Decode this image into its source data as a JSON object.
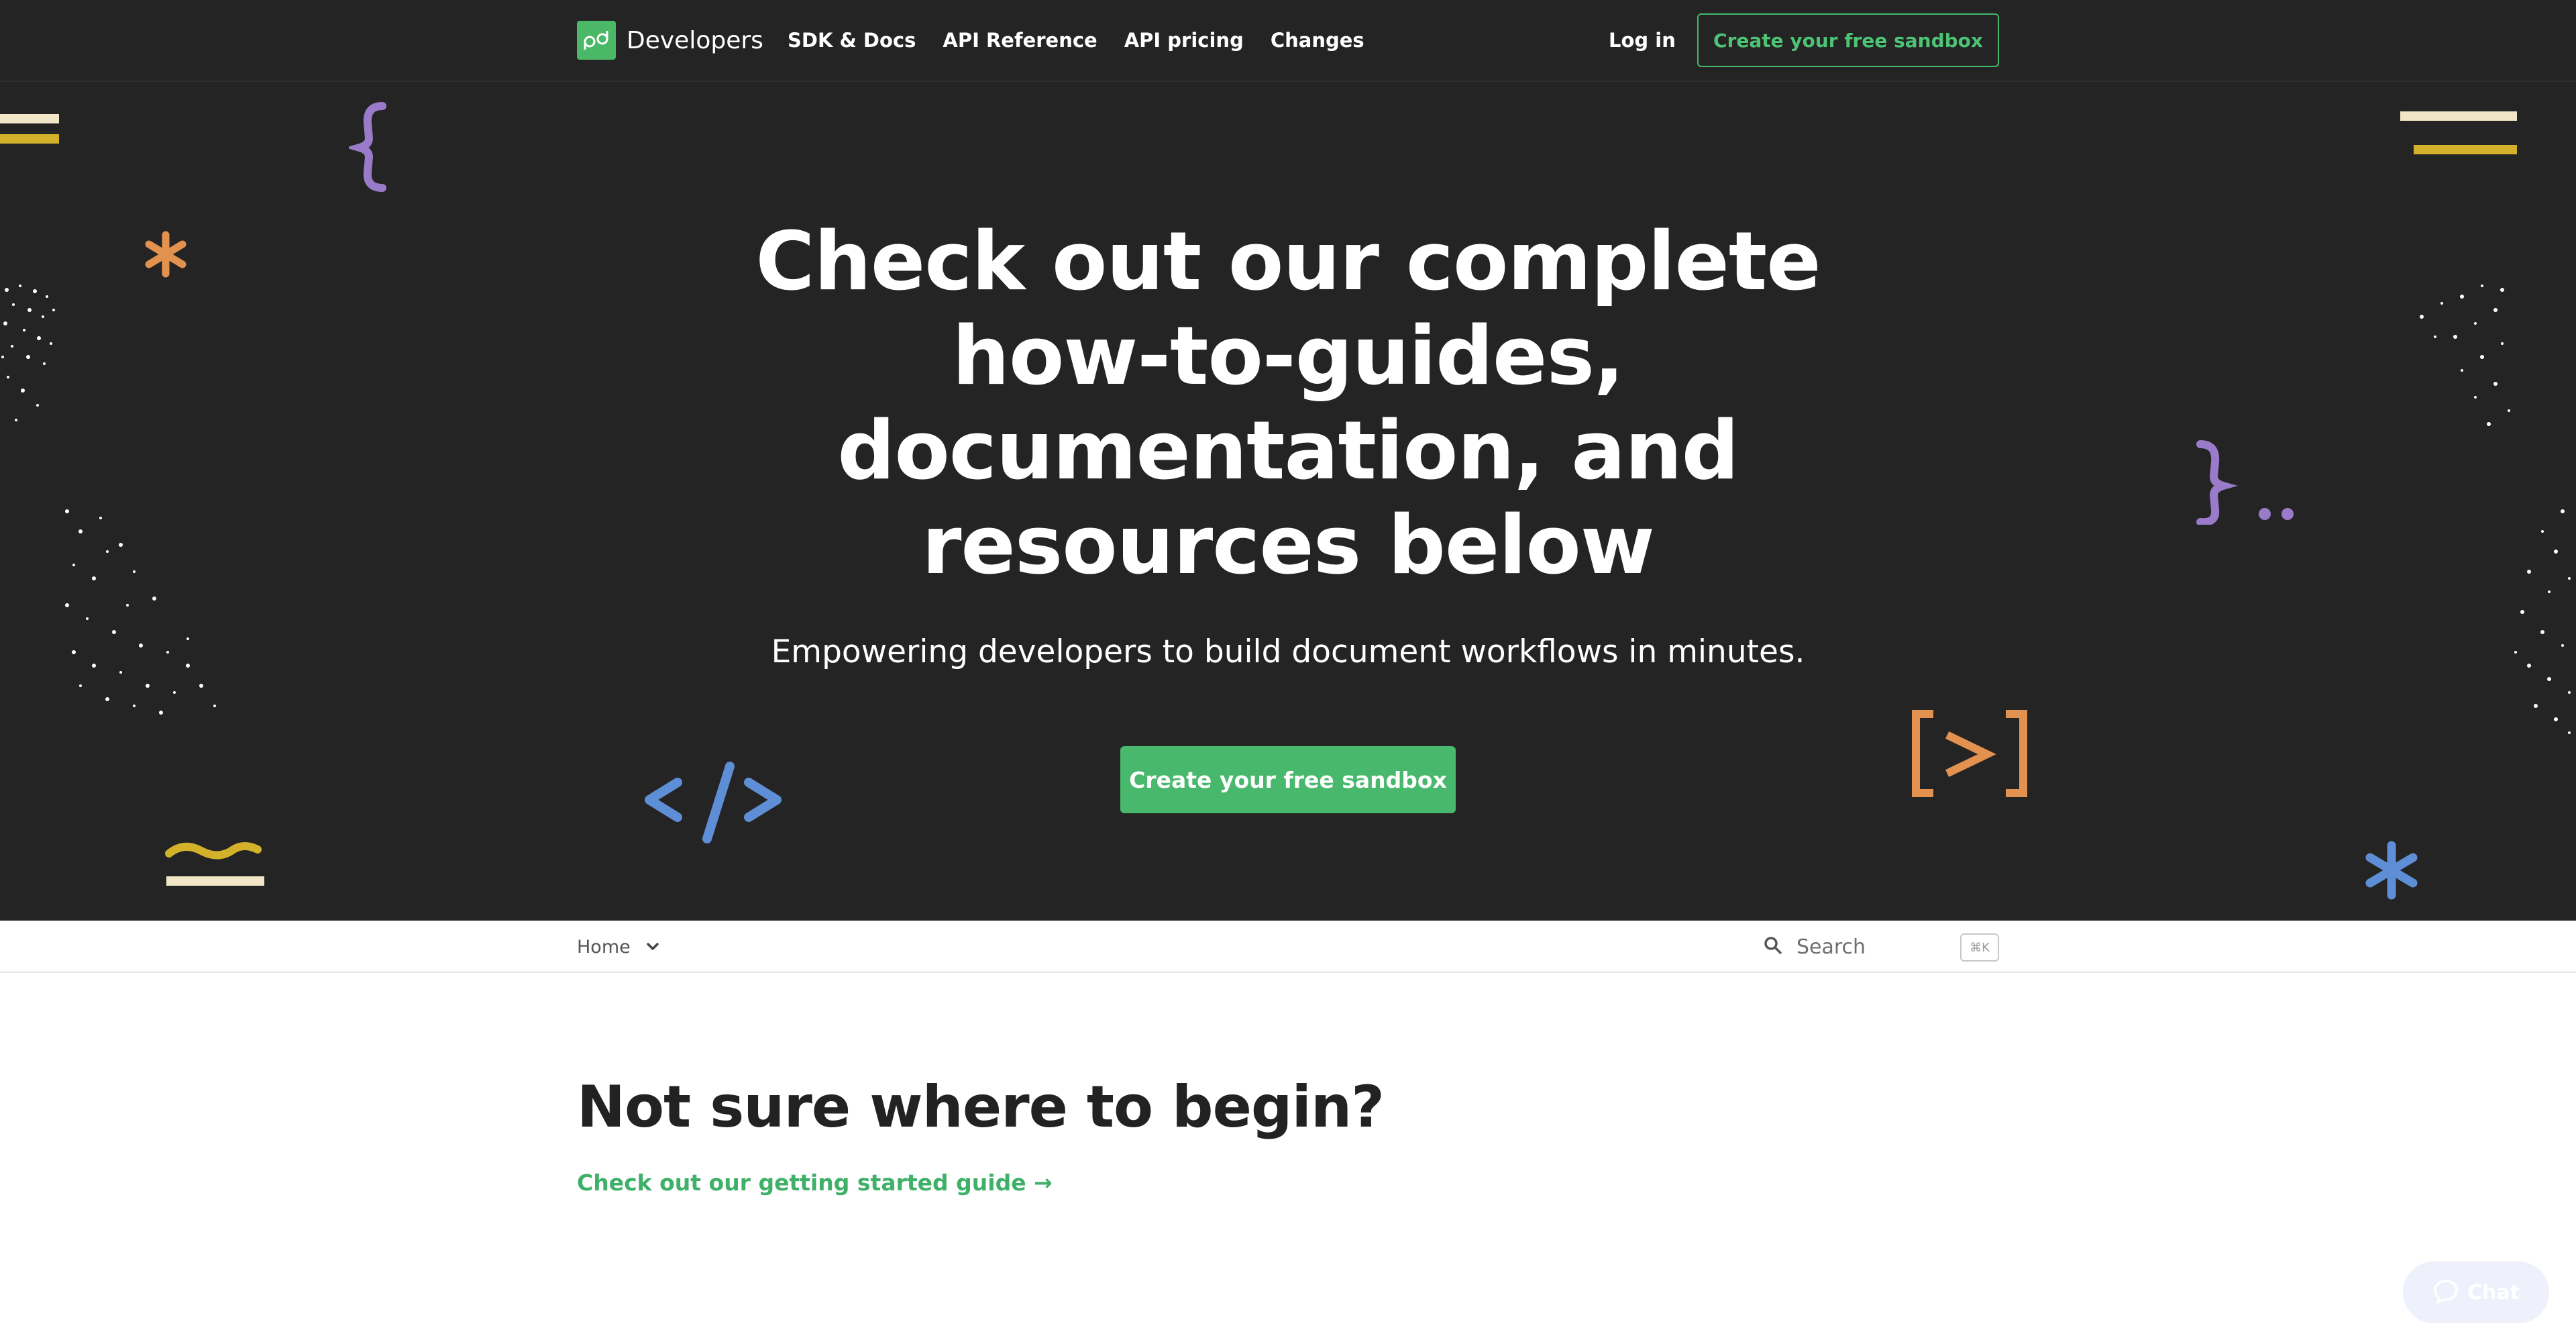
{
  "nav": {
    "brand": "Developers",
    "links": [
      "SDK & Docs",
      "API Reference",
      "API pricing",
      "Changes"
    ],
    "login": "Log in",
    "cta": "Create your free sandbox"
  },
  "hero": {
    "title": "Check out our complete how-to-guides, documentation, and resources below",
    "subtitle": "Empowering developers to build document workflows in minutes.",
    "cta": "Create your free sandbox"
  },
  "subnav": {
    "breadcrumb": "Home",
    "search_placeholder": "Search",
    "shortcut": "⌘K"
  },
  "main": {
    "heading": "Not sure where to begin?",
    "link": "Check out our getting started guide →"
  },
  "chat": {
    "label": "Chat"
  },
  "colors": {
    "dark_bg": "#242424",
    "accent_green": "#48b86c",
    "purple": "#9a7bc9",
    "orange": "#e3914f",
    "blue": "#5e8fd6",
    "yellow": "#d4b12a"
  },
  "icons": [
    "pandadoc-logo-icon",
    "chevron-down-icon",
    "search-icon",
    "chat-bubble-icon"
  ]
}
